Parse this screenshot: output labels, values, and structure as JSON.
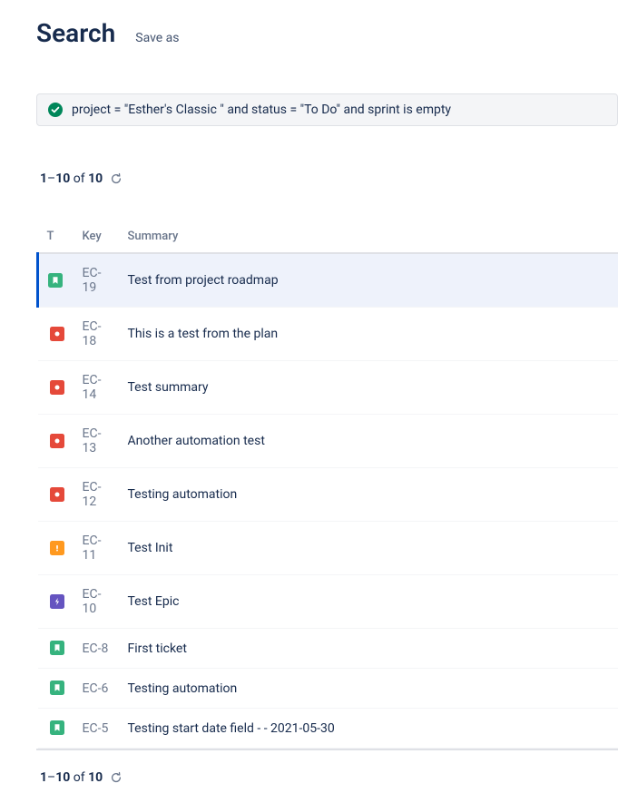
{
  "header": {
    "title": "Search",
    "save_as": "Save as"
  },
  "jql": {
    "query": "project = \"Esther's Classic \" and status = \"To Do\" and sprint is empty",
    "valid": true
  },
  "pager": {
    "range_start": "1",
    "range_end": "10",
    "of_word": "of",
    "total": "10"
  },
  "columns": {
    "type": "T",
    "key": "Key",
    "summary": "Summary"
  },
  "issues": [
    {
      "type": "story",
      "key": "EC-19",
      "summary": "Test from project roadmap",
      "selected": true
    },
    {
      "type": "bug",
      "key": "EC-18",
      "summary": "This is a test from the plan",
      "selected": false
    },
    {
      "type": "bug",
      "key": "EC-14",
      "summary": "Test summary",
      "selected": false
    },
    {
      "type": "bug",
      "key": "EC-13",
      "summary": "Another automation test",
      "selected": false
    },
    {
      "type": "bug",
      "key": "EC-12",
      "summary": "Testing automation",
      "selected": false
    },
    {
      "type": "risk",
      "key": "EC-11",
      "summary": "Test Init",
      "selected": false
    },
    {
      "type": "epic",
      "key": "EC-10",
      "summary": "Test Epic",
      "selected": false
    },
    {
      "type": "story",
      "key": "EC-8",
      "summary": "First ticket",
      "selected": false
    },
    {
      "type": "story",
      "key": "EC-6",
      "summary": "Testing automation",
      "selected": false
    },
    {
      "type": "story",
      "key": "EC-5",
      "summary": "Testing start date field - - 2021-05-30",
      "selected": false
    }
  ]
}
